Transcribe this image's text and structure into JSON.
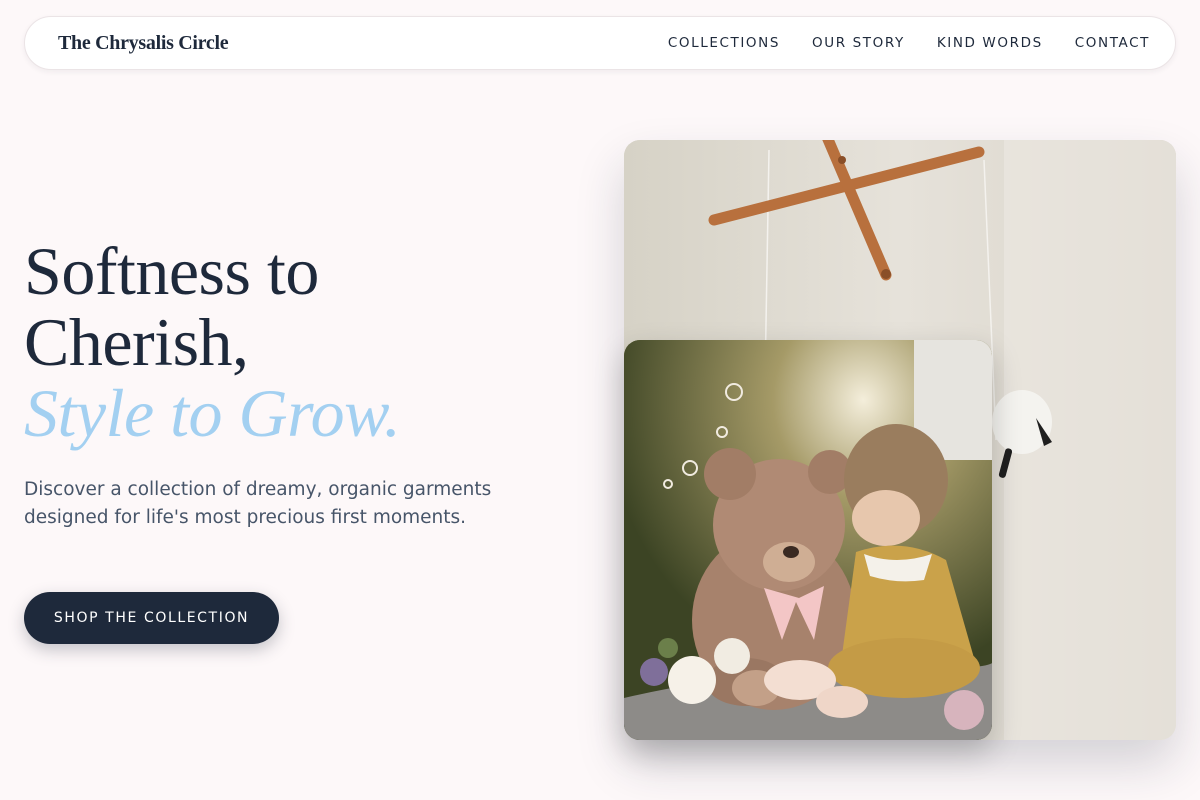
{
  "header": {
    "brand": "The Chrysalis Circle",
    "nav": [
      {
        "label": "COLLECTIONS"
      },
      {
        "label": "OUR STORY"
      },
      {
        "label": "KIND WORDS"
      },
      {
        "label": "CONTACT"
      }
    ]
  },
  "hero": {
    "title_line1": "Softness to",
    "title_line2": "Cherish,",
    "title_accent": "Style to Grow.",
    "description": "Discover a collection of dreamy, organic garments designed for life's most precious first moments.",
    "cta_label": "SHOP THE COLLECTION"
  },
  "colors": {
    "background": "#fdf8f9",
    "navy": "#1e293b",
    "accent_blue": "#a3d0f1",
    "body_text": "#475569"
  }
}
